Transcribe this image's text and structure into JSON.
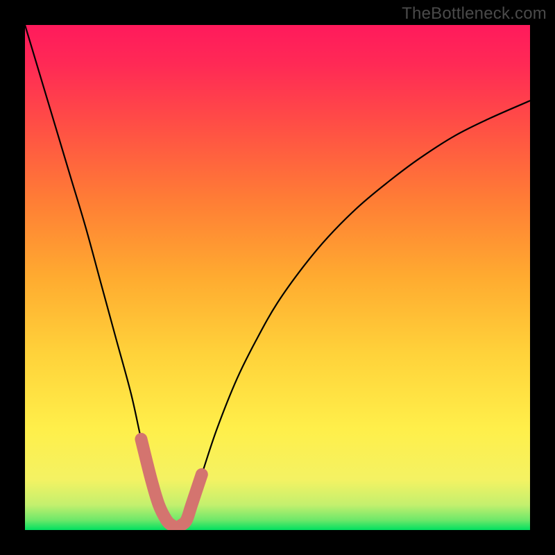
{
  "watermark": "TheBottleneck.com",
  "chart_data": {
    "type": "line",
    "title": "",
    "xlabel": "",
    "ylabel": "",
    "xlim": [
      0,
      100
    ],
    "ylim": [
      0,
      100
    ],
    "x": [
      0,
      3,
      6,
      9,
      12,
      15,
      18,
      21,
      23,
      25,
      26.5,
      28,
      29,
      30,
      31,
      32,
      33,
      35,
      38,
      42,
      46,
      50,
      55,
      60,
      66,
      72,
      78,
      85,
      92,
      100
    ],
    "values": [
      100,
      90,
      80,
      70,
      60,
      49,
      38,
      27,
      18,
      10,
      5,
      2,
      1,
      0.5,
      1,
      2,
      5,
      11,
      20,
      30,
      38,
      45,
      52,
      58,
      64,
      69,
      73.5,
      78,
      81.5,
      85
    ],
    "minimum_x": 30,
    "gradient_stops": [
      {
        "offset": 0.0,
        "color": "#00e060"
      },
      {
        "offset": 0.02,
        "color": "#6fe86a"
      },
      {
        "offset": 0.05,
        "color": "#c4f06e"
      },
      {
        "offset": 0.1,
        "color": "#f4f263"
      },
      {
        "offset": 0.2,
        "color": "#ffef4a"
      },
      {
        "offset": 0.35,
        "color": "#ffd23a"
      },
      {
        "offset": 0.5,
        "color": "#ffab30"
      },
      {
        "offset": 0.65,
        "color": "#ff7e35"
      },
      {
        "offset": 0.8,
        "color": "#ff4f45"
      },
      {
        "offset": 0.92,
        "color": "#ff2a55"
      },
      {
        "offset": 1.0,
        "color": "#ff1a5c"
      }
    ],
    "highlight": {
      "color": "#d4746f",
      "x": [
        23,
        25,
        26.5,
        28,
        29,
        30,
        31,
        32,
        33,
        35
      ],
      "values": [
        18,
        10,
        5,
        2,
        1,
        0.5,
        1,
        2,
        5,
        11
      ]
    }
  }
}
